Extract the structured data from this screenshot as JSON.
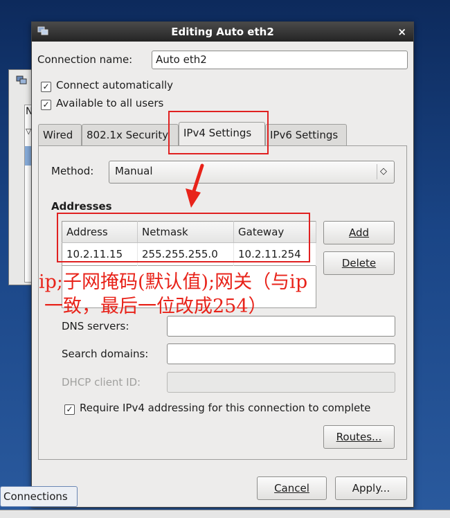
{
  "background_window": {
    "list_letter": "N",
    "list_arrow": "▽"
  },
  "dialog": {
    "title": "Editing Auto eth2",
    "close_glyph": "×",
    "connection_name_label": "Connection name:",
    "connection_name_value": "Auto eth2",
    "connect_automatically_label": "Connect automatically",
    "connect_automatically_checked": "✓",
    "available_all_users_label": "Available to all users",
    "available_all_users_checked": "✓",
    "tabs": [
      {
        "label": "Wired"
      },
      {
        "label": "802.1x Security"
      },
      {
        "label": "IPv4 Settings"
      },
      {
        "label": "IPv6 Settings"
      }
    ],
    "method_label": "Method:",
    "method_value": "Manual",
    "combo_arrow": "◇",
    "addresses_heading": "Addresses",
    "table_headers": [
      "Address",
      "Netmask",
      "Gateway"
    ],
    "table_rows": [
      [
        "10.2.11.15",
        "255.255.255.0",
        "10.2.11.254"
      ]
    ],
    "add_button": "Add",
    "delete_button": "Delete",
    "dns_label": "DNS servers:",
    "search_domains_label": "Search domains:",
    "dhcp_label": "DHCP client ID:",
    "require_ipv4_label": "Require IPv4 addressing for this connection to complete",
    "require_ipv4_checked": "✓",
    "routes_button": "Routes...",
    "cancel_button": "Cancel",
    "apply_button": "Apply..."
  },
  "annotation": {
    "line1": "ip;子网掩码(默认值);网关（与ip",
    "line2": "一致，最后一位改成254）",
    "color": "#e8231a"
  },
  "connections_button": "Connections"
}
